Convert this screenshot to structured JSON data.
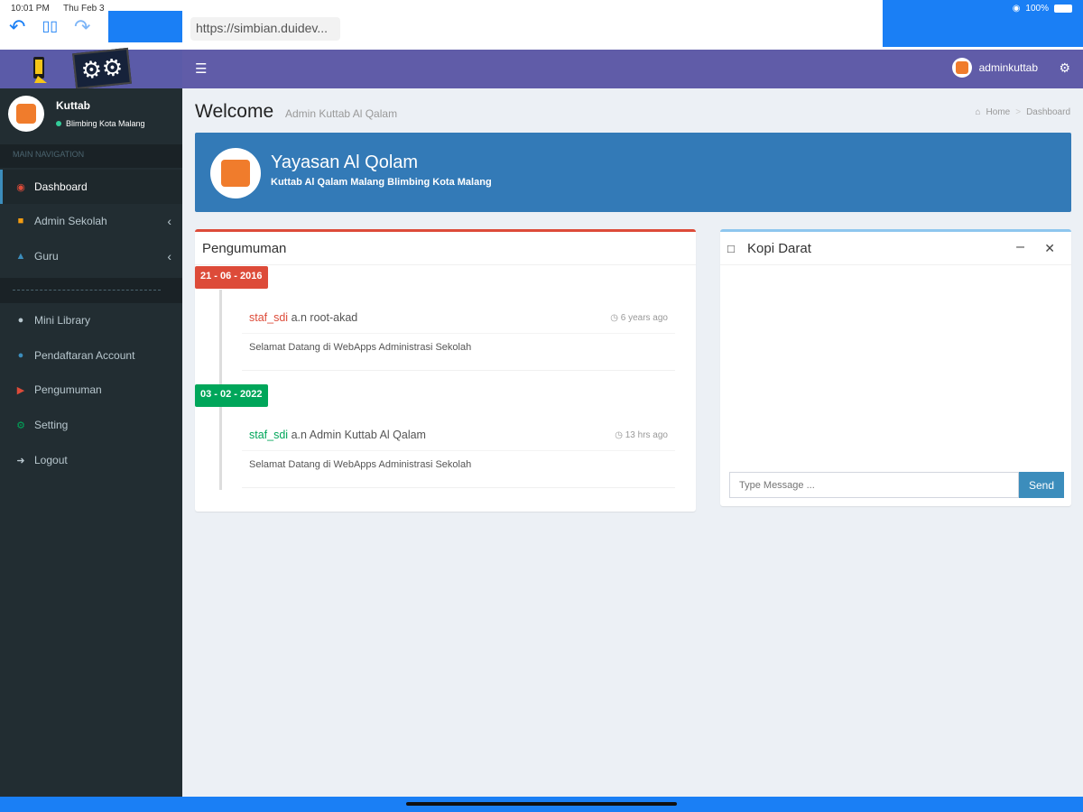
{
  "status": {
    "time": "10:01 PM",
    "date": "Thu Feb 3",
    "battery": "100%"
  },
  "browser": {
    "url": "https://simbian.duidev..."
  },
  "header": {
    "username": "adminkuttab"
  },
  "sidebar": {
    "user_name": "Kuttab",
    "user_status": "Blimbing Kota Malang",
    "nav_header": "MAIN NAVIGATION",
    "items": [
      {
        "label": "Dashboard",
        "icon": "dashboard-icon",
        "color": "#dd4b39"
      },
      {
        "label": "Admin Sekolah",
        "icon": "briefcase-icon",
        "color": "#f39c12"
      },
      {
        "label": "Guru",
        "icon": "graduation-cap-icon",
        "color": "#3c8dbc"
      },
      {
        "label": "Mini Library",
        "icon": "users-icon",
        "color": "#b8c7ce"
      },
      {
        "label": "Pendaftaran Account",
        "icon": "user-plus-icon",
        "color": "#3c8dbc"
      },
      {
        "label": "Pengumuman",
        "icon": "bullhorn-icon",
        "color": "#dd4b39"
      },
      {
        "label": "Setting",
        "icon": "cogs-icon",
        "color": "#00a65a"
      },
      {
        "label": "Logout",
        "icon": "logout-icon",
        "color": "#b8c7ce"
      }
    ]
  },
  "page": {
    "title": "Welcome",
    "subtitle": "Admin Kuttab Al Qalam",
    "breadcrumb": [
      "Home",
      "Dashboard"
    ]
  },
  "banner": {
    "title": "Yayasan Al Qolam",
    "subtitle": "Kuttab Al Qalam Malang Blimbing Kota Malang"
  },
  "announcements": {
    "title": "Pengumuman",
    "items": [
      {
        "date": "21 - 06 - 2016",
        "date_color": "#dd4b39",
        "user": "staf_sdi",
        "user_color": "#dd4b39",
        "author": "a.n root-akad",
        "time": "6 years ago",
        "body": "Selamat Datang di WebApps Administrasi Sekolah"
      },
      {
        "date": "03 - 02 - 2022",
        "date_color": "#00a65a",
        "user": "staf_sdi",
        "user_color": "#00a65a",
        "author": "a.n Admin Kuttab Al Qalam",
        "time": "13 hrs ago",
        "body": "Selamat Datang di WebApps Administrasi Sekolah"
      }
    ]
  },
  "chat": {
    "title": "Kopi Darat",
    "placeholder": "Type Message ...",
    "send_label": "Send"
  }
}
